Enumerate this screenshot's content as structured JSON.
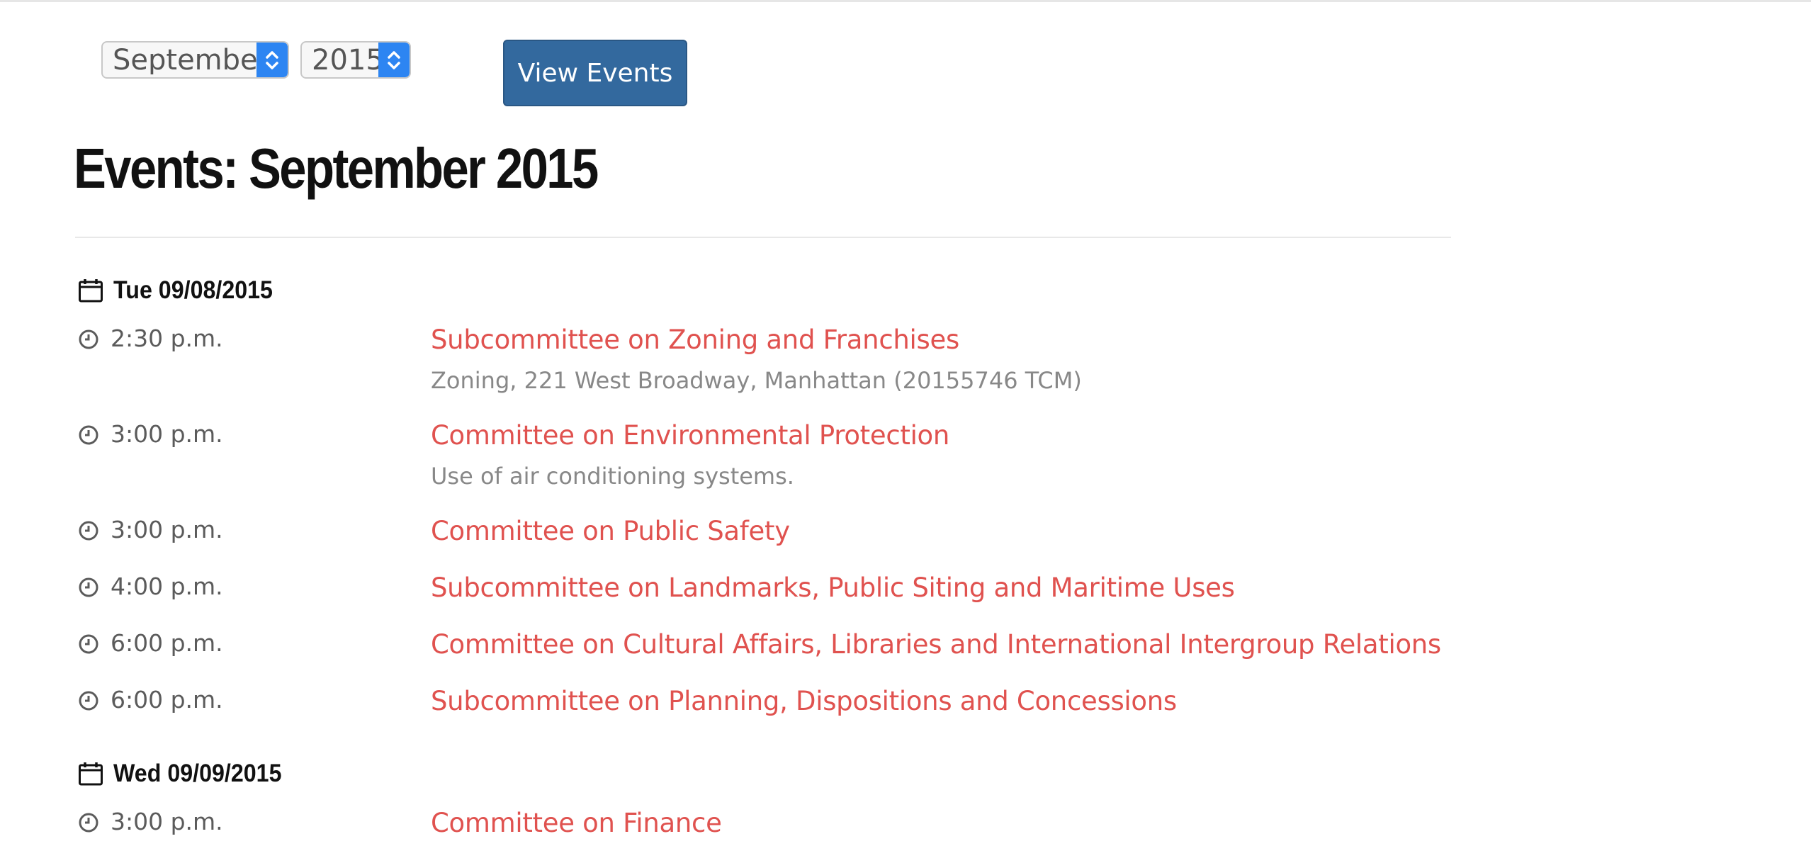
{
  "filters": {
    "month_selected": "September",
    "year_selected": "2015",
    "view_button_label": "View Events"
  },
  "page": {
    "title": "Events: September 2015"
  },
  "colors": {
    "link": "#e0524f",
    "button": "#33699e",
    "select_arrow": "#2d85f2"
  },
  "icons": {
    "date": "calendar-icon",
    "time": "clock-icon",
    "select": "chevron-updown-icon"
  },
  "days": [
    {
      "date": "Tue 09/08/2015",
      "events": [
        {
          "time": "2:30 p.m.",
          "title": "Subcommittee on Zoning and Franchises",
          "description": "Zoning, 221 West Broadway, Manhattan (20155746 TCM)"
        },
        {
          "time": "3:00 p.m.",
          "title": "Committee on Environmental Protection",
          "description": "Use of air conditioning systems."
        },
        {
          "time": "3:00 p.m.",
          "title": "Committee on Public Safety"
        },
        {
          "time": "4:00 p.m.",
          "title": "Subcommittee on Landmarks, Public Siting and Maritime Uses"
        },
        {
          "time": "6:00 p.m.",
          "title": "Committee on Cultural Affairs, Libraries and International Intergroup Relations"
        },
        {
          "time": "6:00 p.m.",
          "title": "Subcommittee on Planning, Dispositions and Concessions"
        }
      ]
    },
    {
      "date": "Wed 09/09/2015",
      "events": [
        {
          "time": "3:00 p.m.",
          "title": "Committee on Finance"
        }
      ]
    }
  ]
}
